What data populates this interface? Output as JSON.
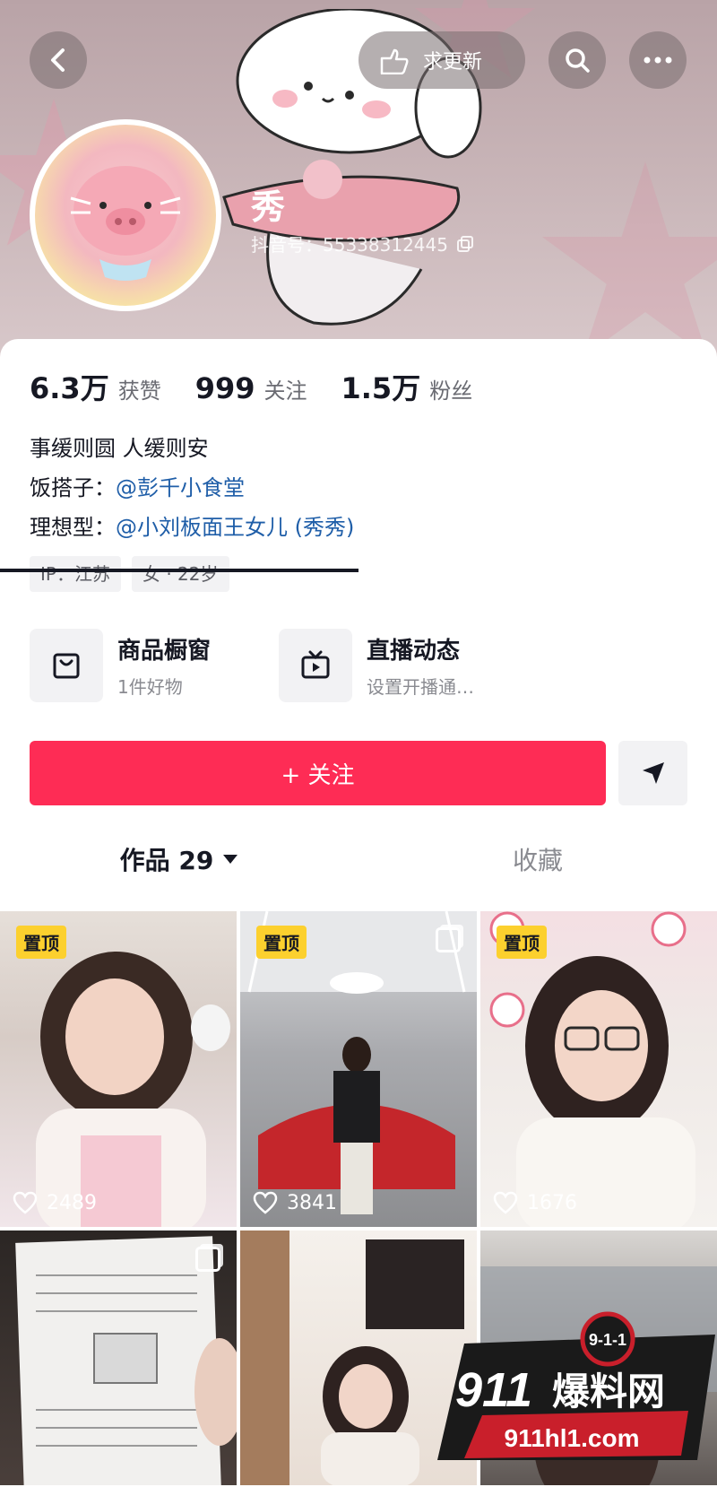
{
  "header": {
    "update_label": "求更新",
    "username": "秀",
    "douyin_id": "抖音号：55338312445"
  },
  "stats": [
    {
      "value": "6.3万",
      "label": "获赞"
    },
    {
      "value": "999",
      "label": "关注"
    },
    {
      "value": "1.5万",
      "label": "粉丝"
    }
  ],
  "bio": {
    "line1": "事缓则圆 人缓则安",
    "line2_prefix": "饭搭子：",
    "line2_mention": "@彭千小食堂",
    "line3_prefix": "理想型：",
    "line3_mention": "@小刘板面王女儿 (秀秀)"
  },
  "tags": [
    "IP：江苏",
    "女 · 22岁"
  ],
  "shortcuts": [
    {
      "title": "商品橱窗",
      "subtitle": "1件好物",
      "icon": "shopping-bag-icon"
    },
    {
      "title": "直播动态",
      "subtitle": "设置开播通…",
      "icon": "tv-icon"
    }
  ],
  "follow_label": "+ 关注",
  "tabs": {
    "works": "作品 29",
    "favorites": "收藏"
  },
  "posts": [
    {
      "pinned": "置顶",
      "likes": "2489"
    },
    {
      "pinned": "置顶",
      "likes": "3841"
    },
    {
      "pinned": "置顶",
      "likes": "1676"
    },
    {
      "pinned": "",
      "likes": ""
    },
    {
      "pinned": "",
      "likes": ""
    },
    {
      "pinned": "",
      "likes": ""
    }
  ],
  "watermark": {
    "badge": "9-1-1",
    "brand_num": "911",
    "brand_text": "爆料网",
    "url": "911hl1.com"
  },
  "colors": {
    "accent": "#fe2c55",
    "mention": "#1f5ea8",
    "pin_badge": "#fcd02e"
  }
}
